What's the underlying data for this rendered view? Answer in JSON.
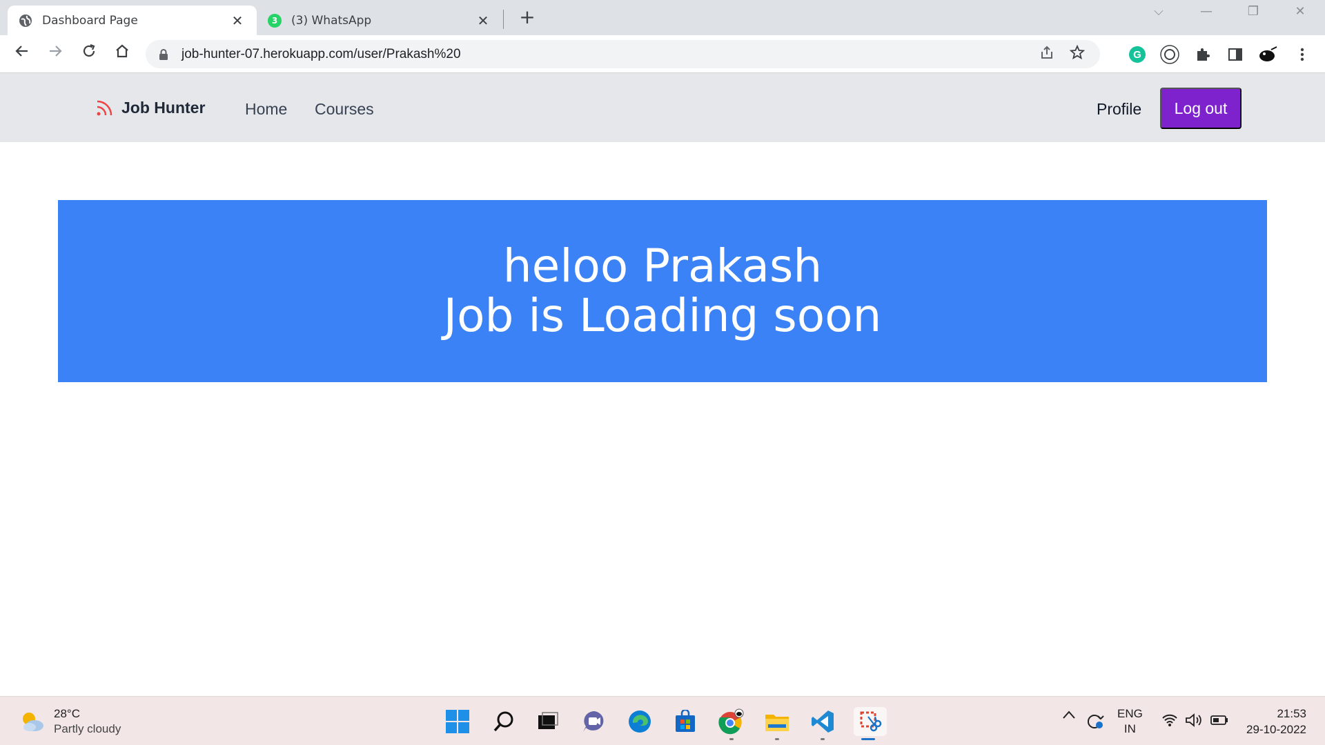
{
  "browser": {
    "tabs": [
      {
        "title": "Dashboard Page",
        "favicon": "globe-icon",
        "active": true
      },
      {
        "title": "(3) WhatsApp",
        "favicon": "whatsapp-icon",
        "badge": "3",
        "active": false
      }
    ],
    "close_glyph": "✕",
    "new_tab_glyph": "+",
    "url": "job-hunter-07.herokuapp.com/user/Prakash%20",
    "window_controls": {
      "dropdown": "⌵",
      "minimize": "—",
      "restore": "❐",
      "close": "✕"
    }
  },
  "site": {
    "brand": "Job Hunter",
    "nav_links": [
      "Home",
      "Courses"
    ],
    "profile_label": "Profile",
    "logout_label": "Log out",
    "colors": {
      "nav_bg": "#e5e7eb",
      "logout_bg": "#7e22ce",
      "banner_bg": "#3b82f6",
      "brand_icon": "#ef4444"
    }
  },
  "banner": {
    "line1": "heloo Prakash",
    "line2": "Job is Loading soon"
  },
  "taskbar": {
    "weather": {
      "temp": "28°C",
      "desc": "Partly cloudy"
    },
    "apps": [
      "start-icon",
      "search-icon",
      "task-view-icon",
      "chat-icon",
      "edge-icon",
      "store-icon",
      "chrome-icon",
      "file-explorer-icon",
      "vscode-icon",
      "snipping-tool-icon"
    ],
    "language": {
      "line1": "ENG",
      "line2": "IN"
    },
    "clock": {
      "time": "21:53",
      "date": "29-10-2022"
    }
  }
}
